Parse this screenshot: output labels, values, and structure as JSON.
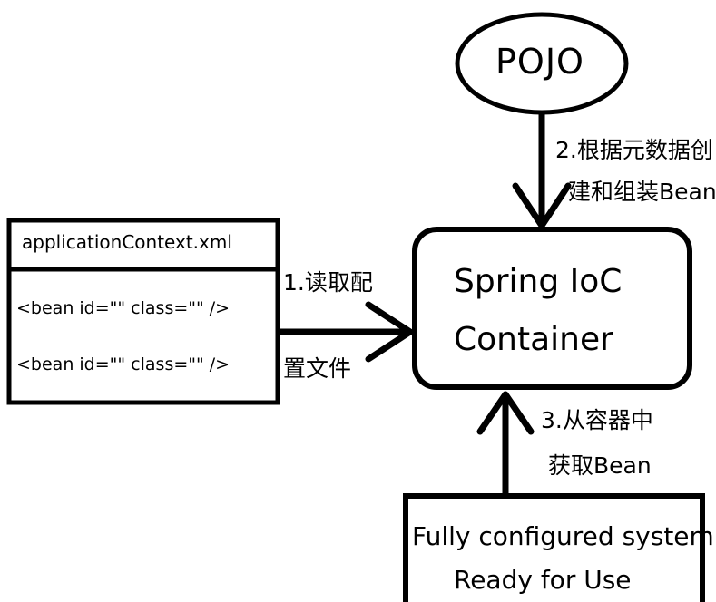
{
  "diagram": {
    "pojo": "POJO",
    "config_file": {
      "title": "applicationContext.xml",
      "line1": "<bean id=\"\" class=\"\" />",
      "line2": "<bean id=\"\" class=\"\" />"
    },
    "step1": {
      "line1": "1.读取配",
      "line2": "置文件"
    },
    "step2": {
      "line1": "2.根据元数据创",
      "line2": "建和组装Bean"
    },
    "container": {
      "line1": "Spring IoC",
      "line2": "Container"
    },
    "step3": {
      "line1": "3.从容器中",
      "line2": "获取Bean"
    },
    "system": {
      "line1": "Fully configured system",
      "line2": "Ready for Use"
    }
  }
}
